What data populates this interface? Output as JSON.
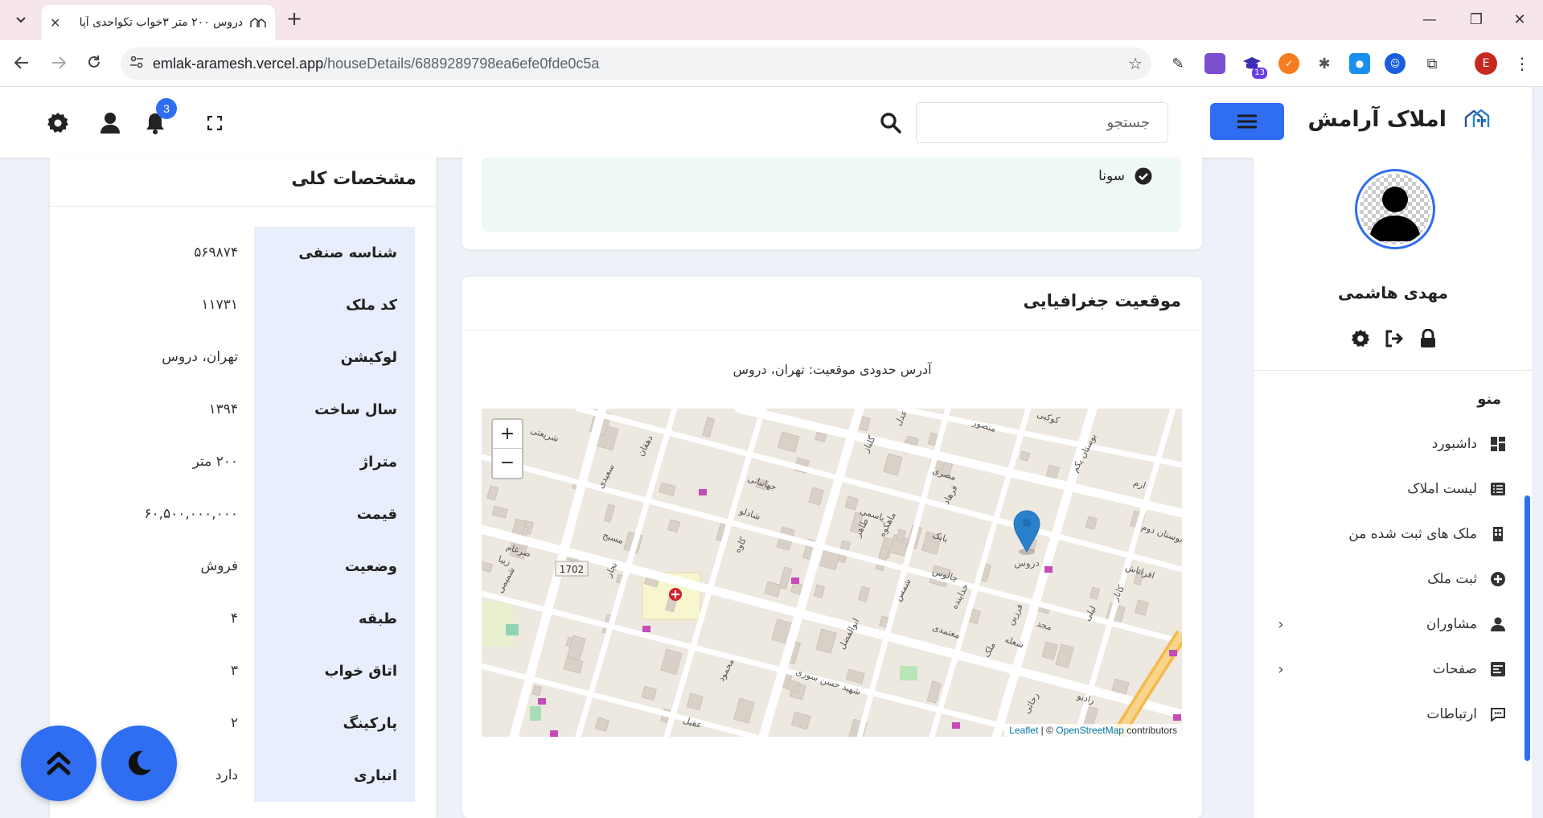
{
  "browser": {
    "tab_title": "دروس ۲۰۰ متر ۳خواب تکواحدی آپا",
    "url_host": "emlak-aramesh.vercel.app",
    "url_path": "/houseDetails/6889289798ea6efe0fde0c5a",
    "profile_initial": "E",
    "ext_badge": "13"
  },
  "header": {
    "brand_name": "املاک آرامش",
    "search_placeholder": "جستجو",
    "notification_count": "3"
  },
  "sidebar": {
    "user_name": "مهدی هاشمی",
    "menu_title": "منو",
    "items": [
      {
        "label": "داشبورد",
        "icon": "dashboard-icon",
        "has_children": false
      },
      {
        "label": "لیست املاک",
        "icon": "list-icon",
        "has_children": false
      },
      {
        "label": "ملک های ثبت شده من",
        "icon": "building-icon",
        "has_children": false
      },
      {
        "label": "ثبت ملک",
        "icon": "plus-circle-icon",
        "has_children": false
      },
      {
        "label": "مشاوران",
        "icon": "users-icon",
        "has_children": true
      },
      {
        "label": "صفحات",
        "icon": "pages-icon",
        "has_children": true
      },
      {
        "label": "ارتباطات",
        "icon": "chat-icon",
        "has_children": false
      }
    ]
  },
  "amenities": {
    "visible_item": "سونا"
  },
  "location": {
    "title": "موقعیت جغرافیایی",
    "address": "آدرس حدودی موقعیت: تهران، دروس",
    "marker_label": "دروس",
    "road_shield": "1702",
    "zoom_in": "+",
    "zoom_out": "−",
    "attribution_leaflet": "Leaflet",
    "attribution_sep": " | © ",
    "attribution_osm": "OpenStreetMap",
    "attribution_tail": " contributors",
    "street_labels": [
      "شریعتی",
      "دهقان",
      "کوکبی",
      "عدل",
      "منصور",
      "گلناز",
      "مصری",
      "فرهاد",
      "یاسمی",
      "طاهر",
      "چالوس",
      "خداینده",
      "معتمدی",
      "شمس",
      "شادلو",
      "کاوه",
      "جهانبانی",
      "سعیدی",
      "مسیح",
      "نجار",
      "زیبا",
      "شمیمی",
      "ضرغام",
      "ملک",
      "شعله",
      "فرزین",
      "مجد",
      "ابوالفضل",
      "عقیل",
      "محمود",
      "شهید حسن سوری",
      "رجائی",
      "رادیو",
      "لیلی",
      "افراتاش",
      "کاتار",
      "بوستان دوم",
      "بوستان یکم",
      "ارم",
      "ماهکوه",
      "بابک"
    ]
  },
  "specs": {
    "title": "مشخصات کلی",
    "rows": [
      {
        "key": "شناسه صنفی",
        "value": "۵۶۹۸۷۴"
      },
      {
        "key": "کد ملک",
        "value": "۱۱۷۳۱"
      },
      {
        "key": "لوکیشن",
        "value": "تهران، دروس"
      },
      {
        "key": "سال ساخت",
        "value": "۱۳۹۴"
      },
      {
        "key": "متراژ",
        "value": "۲۰۰ متر"
      },
      {
        "key": "قیمت",
        "value": "۶۰,۵۰۰,۰۰۰,۰۰۰"
      },
      {
        "key": "وضعیت",
        "value": "فروش"
      },
      {
        "key": "طبقه",
        "value": "۴"
      },
      {
        "key": "اتاق خواب",
        "value": "۳"
      },
      {
        "key": "پارکینگ",
        "value": "۲"
      },
      {
        "key": "انباری",
        "value": "دارد"
      }
    ]
  },
  "colors": {
    "primary": "#2f6df1",
    "amenity_bg": "#eef8f4",
    "spec_key_bg": "#e8eefb",
    "marker": "#2a81cb"
  }
}
